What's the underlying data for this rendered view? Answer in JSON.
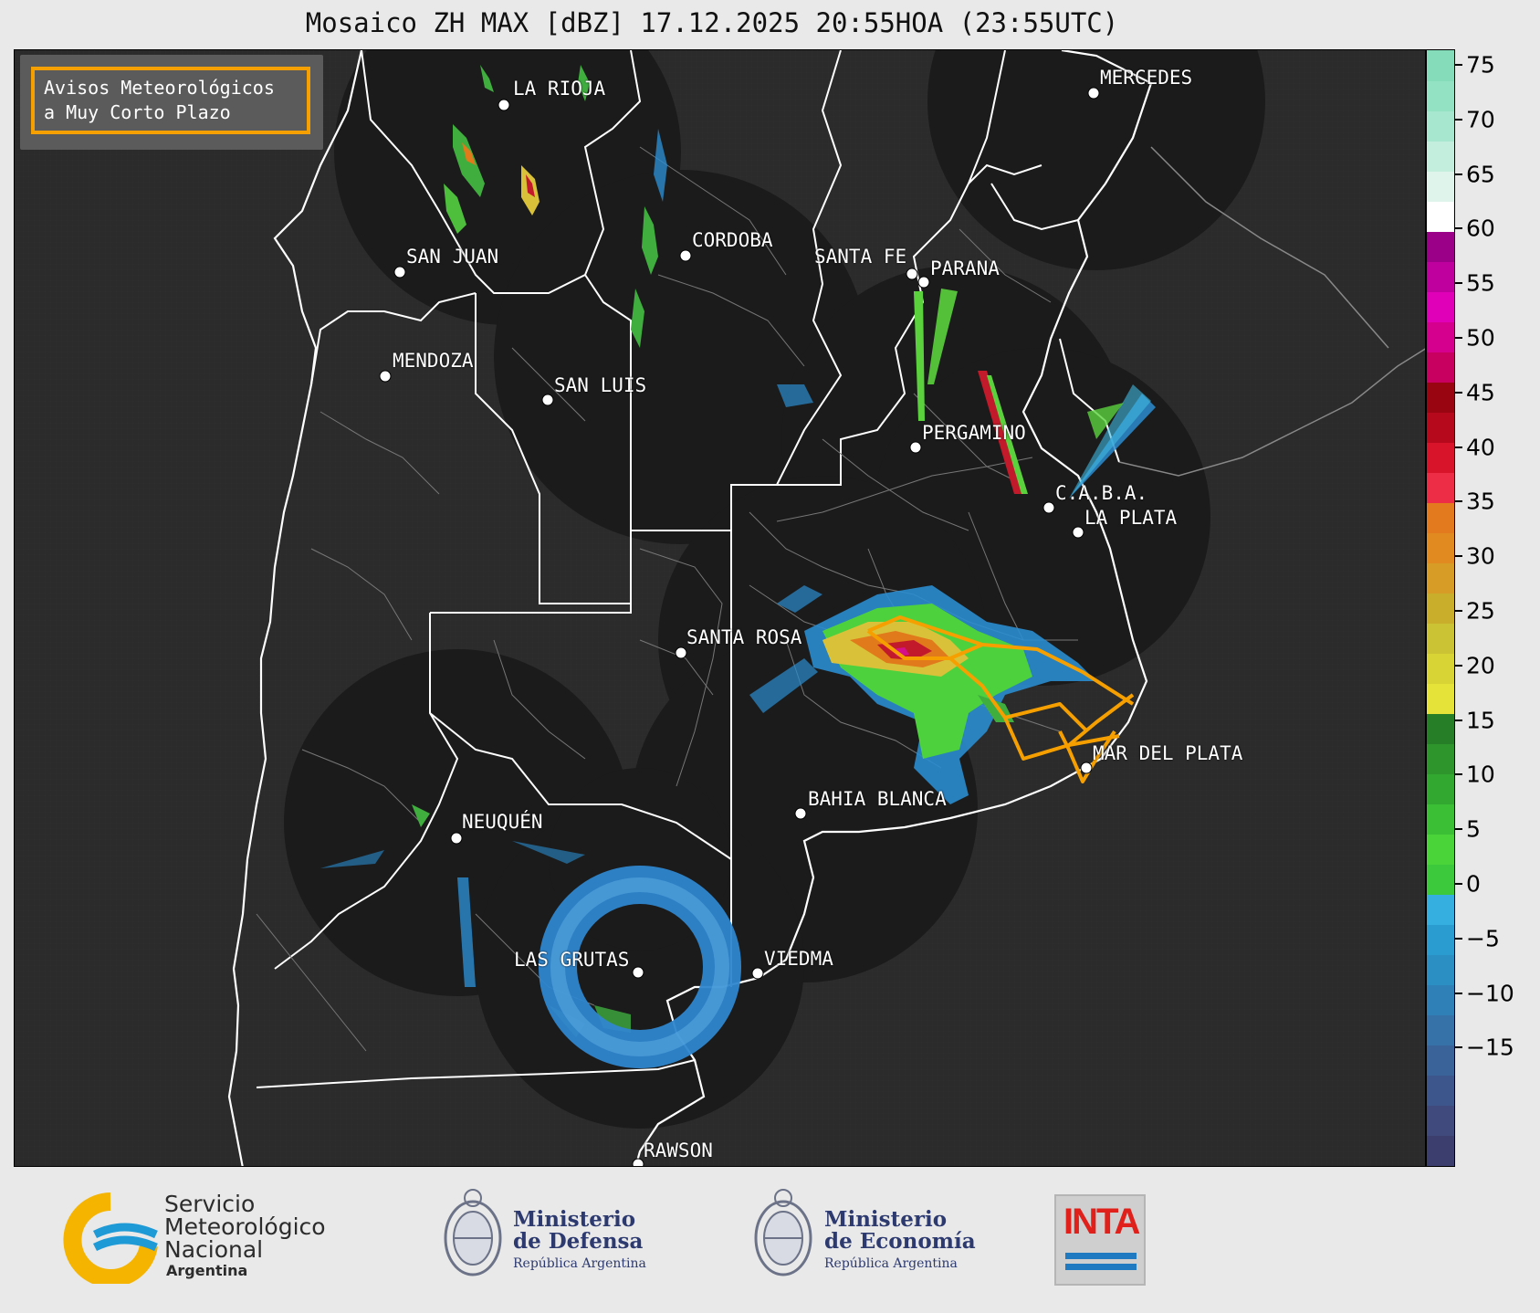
{
  "title": "Mosaico ZH MAX [dBZ] 17.12.2025 20:55HOA (23:55UTC)",
  "warning_box": {
    "line1": "Avisos Meteorológicos",
    "line2": "a Muy Corto Plazo",
    "border_color": "#f6a000"
  },
  "cities": [
    {
      "name": "LA RIOJA"
    },
    {
      "name": "SAN JUAN"
    },
    {
      "name": "CORDOBA"
    },
    {
      "name": "SANTA FE"
    },
    {
      "name": "PARANA"
    },
    {
      "name": "MENDOZA"
    },
    {
      "name": "SAN LUIS"
    },
    {
      "name": "MERCEDES"
    },
    {
      "name": "PERGAMINO"
    },
    {
      "name": "C.A.B.A."
    },
    {
      "name": "LA PLATA"
    },
    {
      "name": "SANTA ROSA"
    },
    {
      "name": "MAR DEL PLATA"
    },
    {
      "name": "BAHIA BLANCA"
    },
    {
      "name": "NEUQUÉN"
    },
    {
      "name": "LAS GRUTAS"
    },
    {
      "name": "VIEDMA"
    },
    {
      "name": "RAWSON"
    }
  ],
  "colorbar": {
    "ticks": [
      "75",
      "70",
      "65",
      "60",
      "55",
      "50",
      "45",
      "40",
      "35",
      "30",
      "25",
      "20",
      "15",
      "10",
      "5",
      "0",
      "−5",
      "−10",
      "−15"
    ]
  },
  "logos": {
    "smn": {
      "line1": "Servicio",
      "line2": "Meteorológico",
      "line3": "Nacional",
      "line4": "Argentina"
    },
    "defensa": {
      "line1": "Ministerio",
      "line2": "de Defensa",
      "line3": "República Argentina"
    },
    "economia": {
      "line1": "Ministerio",
      "line2": "de Economía",
      "line3": "República Argentina"
    },
    "inta": {
      "text": "INTA"
    }
  },
  "colors": {
    "map_background": "#2b2b2b",
    "radar_coverage": "#1c1c1c",
    "province_border": "#ffffff",
    "warning_polygon": "#f5a000"
  }
}
